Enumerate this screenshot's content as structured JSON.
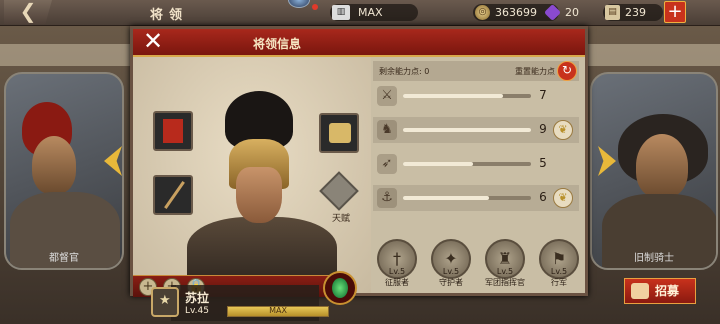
{
  "topbar": {
    "back_icon": "back-arrow-icon",
    "title": "将领",
    "max_label": "MAX",
    "coins": "363699",
    "gems": "20",
    "scrolls": "239",
    "plus_icon": "plus-icon"
  },
  "side_cards": {
    "left_name": "都督官",
    "right_name": "旧制骑士"
  },
  "recruit_button": "招募",
  "panel": {
    "title": "将领信息",
    "close_icon": "close-icon",
    "talent_label": "天赋",
    "hero_name": "苏拉",
    "hero_level": "Lv.45",
    "exp_label": "MAX",
    "exp_fraction": 1.0
  },
  "stats": {
    "points_label": "剩余能力点: 0",
    "reset_label": "重置能力点",
    "rows": [
      {
        "icon": "sword-icon",
        "value": "7",
        "fill": 0.78,
        "laurel": false
      },
      {
        "icon": "horse-icon",
        "value": "9",
        "fill": 1.0,
        "laurel": true
      },
      {
        "icon": "bow-icon",
        "value": "5",
        "fill": 0.55,
        "laurel": false
      },
      {
        "icon": "anchor-icon",
        "value": "6",
        "fill": 0.67,
        "laurel": true
      }
    ]
  },
  "skills": [
    {
      "level": "Lv.5",
      "name": "征服者",
      "icon": "sword-medallion-icon"
    },
    {
      "level": "Lv.5",
      "name": "守护者",
      "icon": "shield-medallion-icon"
    },
    {
      "level": "Lv.5",
      "name": "军团指挥官",
      "icon": "helmet-medallion-icon"
    },
    {
      "level": "Lv.5",
      "name": "行军",
      "icon": "march-medallion-icon"
    }
  ],
  "colors": {
    "header_red": "#a8281c",
    "panel_bg": "#c9bea5",
    "gold": "#e8b83a"
  }
}
